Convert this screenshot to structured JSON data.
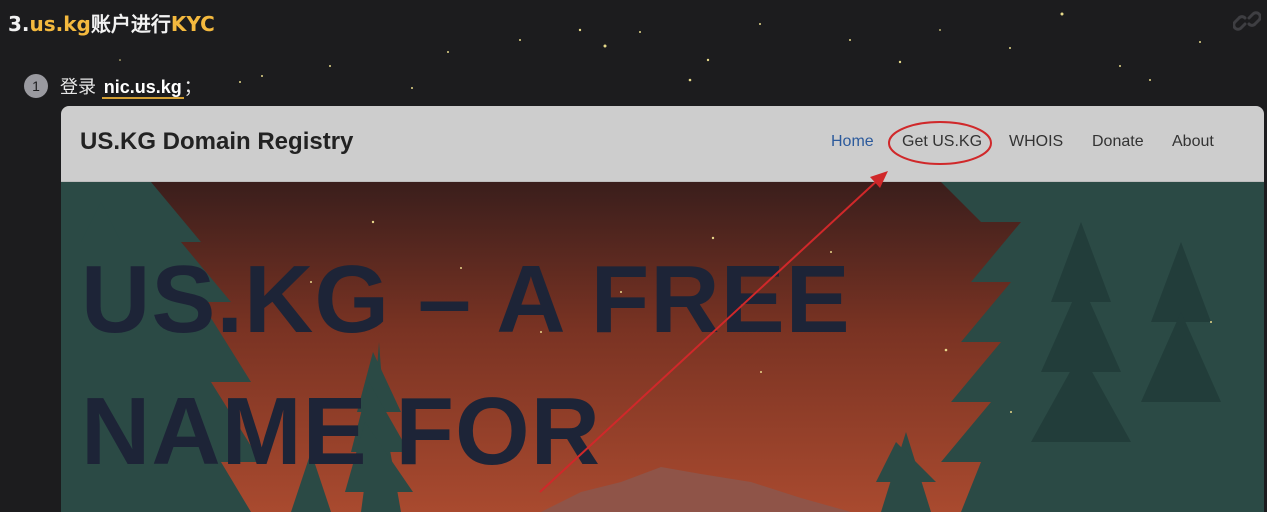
{
  "heading": {
    "prefix": "3.",
    "domain": "us.kg",
    "middle": "账户进行",
    "suffix": "KYC"
  },
  "link_icon": "link-icon",
  "step": {
    "number": "1",
    "text_before": "登录 ",
    "link_text": "nic.us.kg",
    "text_after": "；"
  },
  "site": {
    "brand": "US.KG Domain Registry",
    "nav": [
      {
        "label": "Home",
        "active": true
      },
      {
        "label": "Get US.KG",
        "highlighted": true
      },
      {
        "label": "WHOIS"
      },
      {
        "label": "Donate"
      },
      {
        "label": "About"
      }
    ],
    "hero_title": "US.KG – A FREE NAME FOR"
  },
  "colors": {
    "page_bg": "#1c1c1e",
    "heading_highlight": "#f4b93e",
    "navbar_bg": "#cdcdcd",
    "nav_active": "#2c5a9c",
    "hero_title": "#1d2437",
    "annotation": "#d0282a"
  }
}
